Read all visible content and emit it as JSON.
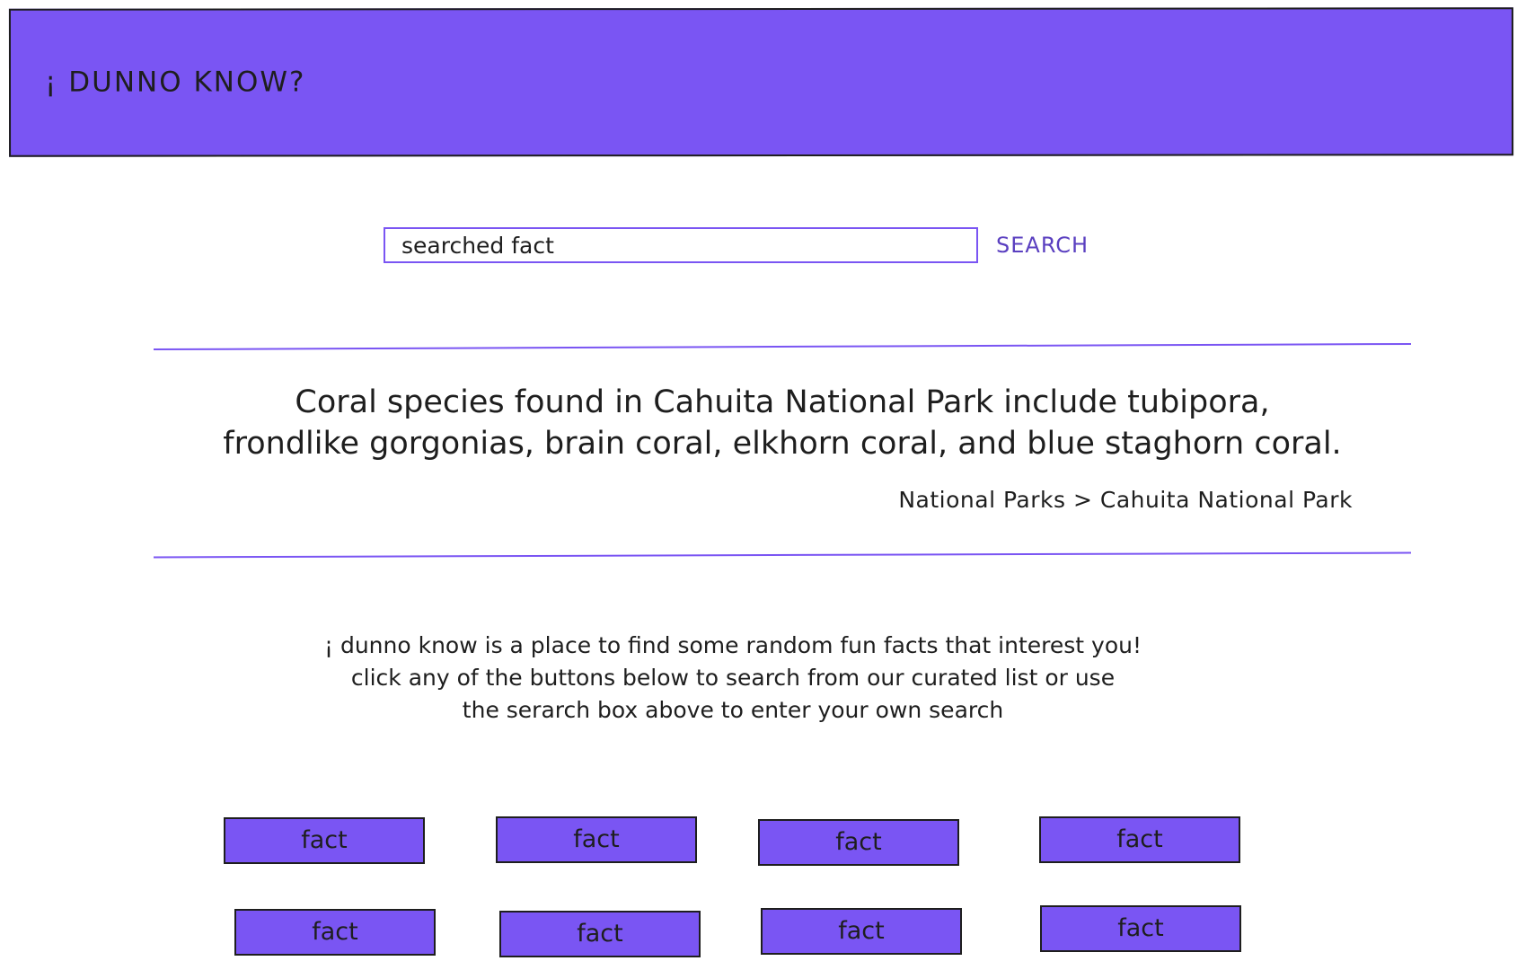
{
  "header": {
    "title": "¡ DUNNO KNOW?"
  },
  "search": {
    "value": "searched fact",
    "button_label": "SEARCH"
  },
  "fact": {
    "line1": "Coral species found in Cahuita National Park include tubipora,",
    "line2": "frondlike gorgonias, brain coral, elkhorn coral, and blue staghorn coral.",
    "path": "National Parks > Cahuita National Park"
  },
  "intro": {
    "line1": "¡ dunno know is a place to find some random fun facts that interest you!",
    "line2": "click any of the buttons below to search from our curated list or use",
    "line3": "the serarch box above to enter your own search"
  },
  "fact_buttons": [
    {
      "label": "fact"
    },
    {
      "label": "fact"
    },
    {
      "label": "fact"
    },
    {
      "label": "fact"
    },
    {
      "label": "fact"
    },
    {
      "label": "fact"
    },
    {
      "label": "fact"
    },
    {
      "label": "fact"
    }
  ],
  "colors": {
    "accent": "#7a55f3",
    "search_text": "#5a3fc0",
    "ink": "#1e1e1e"
  }
}
